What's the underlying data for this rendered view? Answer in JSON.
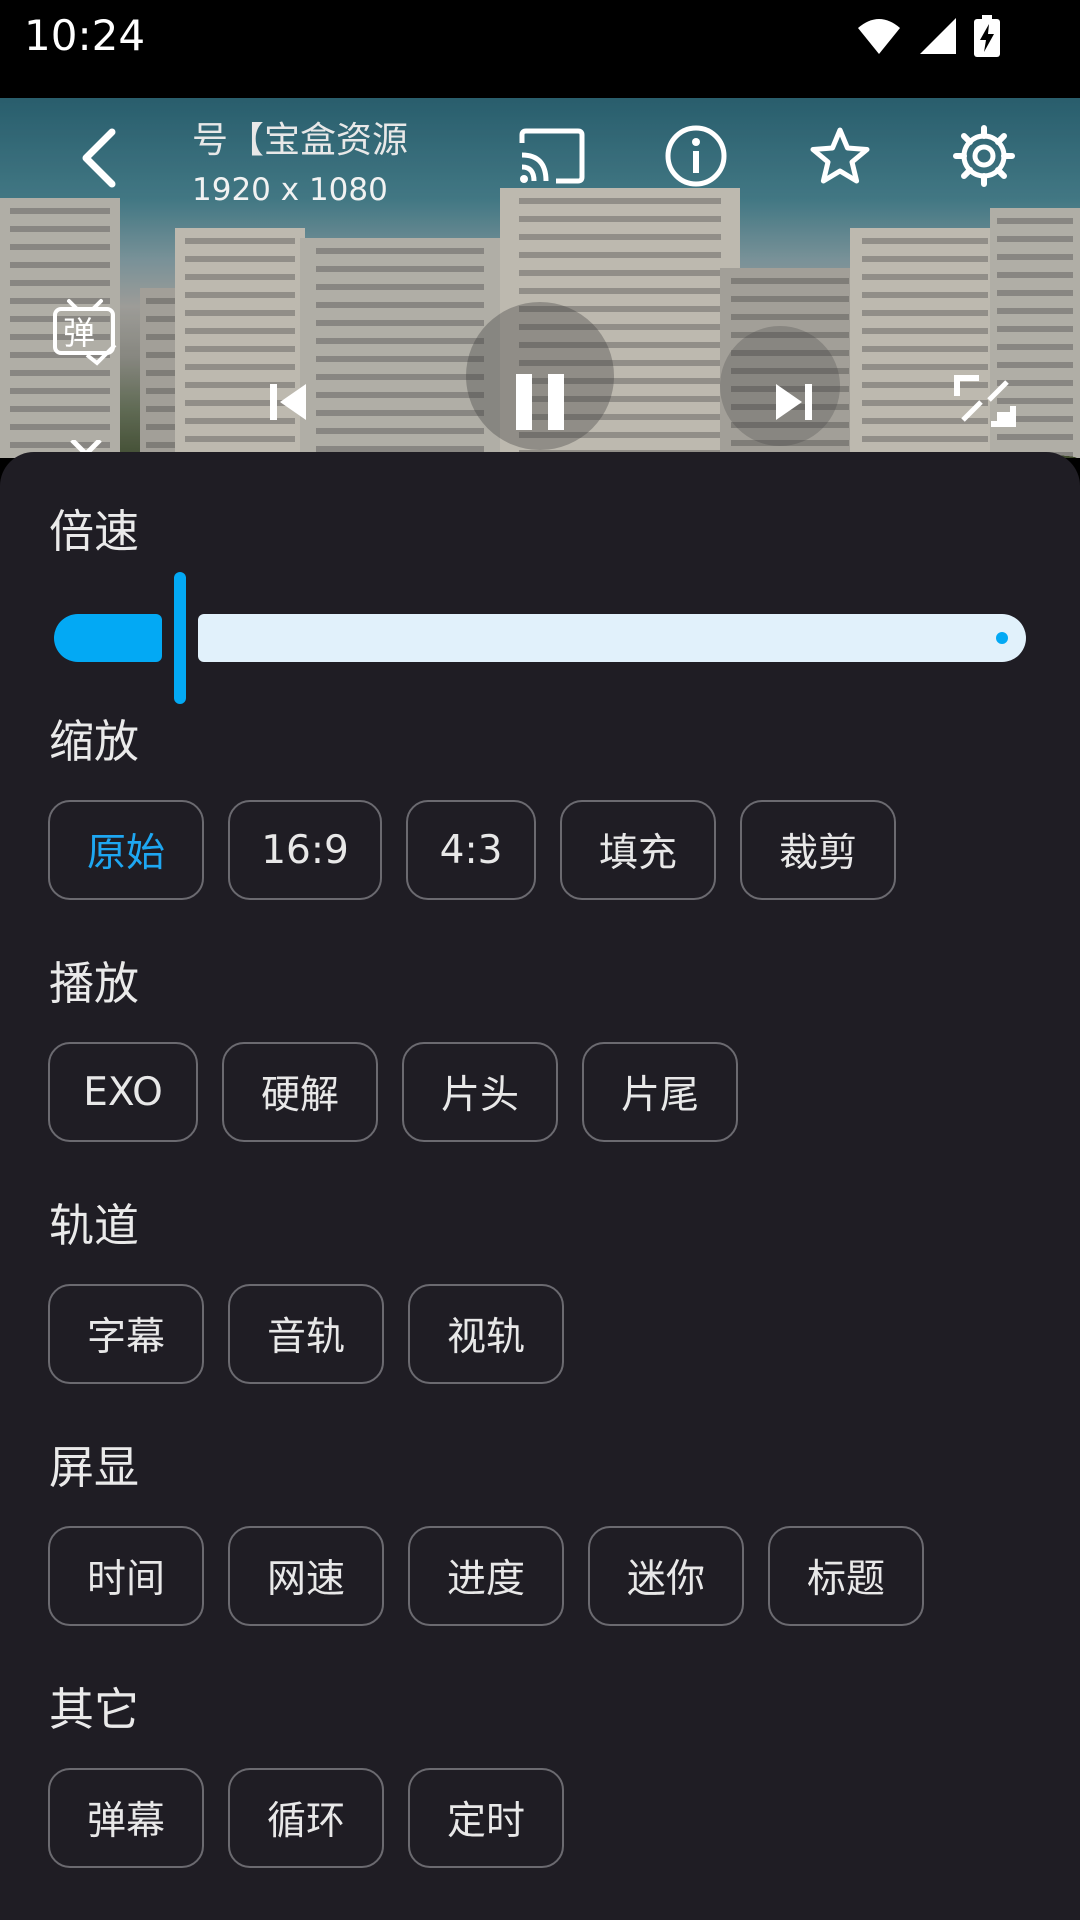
{
  "status_bar": {
    "time": "10:24"
  },
  "player": {
    "title": "号【宝盒资源",
    "resolution": "1920 x 1080",
    "speed_value": 0.0
  },
  "sections": {
    "speed": {
      "label": "倍速"
    },
    "scale": {
      "label": "缩放",
      "options": [
        "原始",
        "16:9",
        "4:3",
        "填充",
        "裁剪"
      ],
      "selected": "原始"
    },
    "playback": {
      "label": "播放",
      "options": [
        "EXO",
        "硬解",
        "片头",
        "片尾"
      ]
    },
    "track": {
      "label": "轨道",
      "options": [
        "字幕",
        "音轨",
        "视轨"
      ]
    },
    "display": {
      "label": "屏显",
      "options": [
        "时间",
        "网速",
        "进度",
        "迷你",
        "标题"
      ]
    },
    "other": {
      "label": "其它",
      "options": [
        "弹幕",
        "循环",
        "定时"
      ]
    }
  },
  "icons": {
    "back": "back-arrow-icon",
    "cast": "cast-icon",
    "info": "info-icon",
    "favorite": "star-icon",
    "settings": "gear-icon",
    "danmaku": "danmaku-icon",
    "prev": "skip-previous-icon",
    "pause": "pause-icon",
    "next": "skip-next-icon",
    "fullscreen": "fullscreen-exit-icon",
    "collapse": "chevron-down-icon"
  },
  "colors": {
    "accent": "#03a9f4",
    "sheet": "#1f1d24",
    "track": "#e1f1fb"
  }
}
